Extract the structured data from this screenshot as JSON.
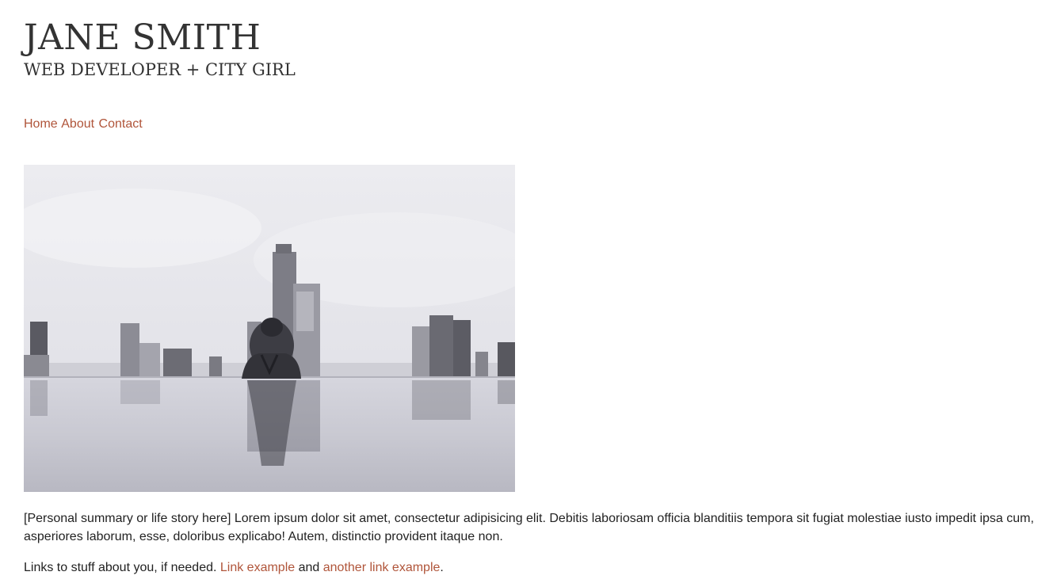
{
  "header": {
    "title": "JANE SMITH",
    "tagline": "WEB DEVELOPER + CITY GIRL"
  },
  "nav": {
    "items": [
      {
        "label": "Home"
      },
      {
        "label": "About"
      },
      {
        "label": "Contact"
      }
    ]
  },
  "hero": {
    "alt": "Woman in an infinity pool facing a city skyline",
    "style": "black-and-white photograph"
  },
  "content": {
    "summary": "[Personal summary or life story here] Lorem ipsum dolor sit amet, consectetur adipisicing elit. Debitis laboriosam officia blanditiis tempora sit fugiat molestiae iusto impedit ipsa cum, asperiores laborum, esse, doloribus explicabo! Autem, distinctio provident itaque non.",
    "links_prefix": "Links to stuff about you, if needed. ",
    "link1": "Link example",
    "links_middle": " and ",
    "link2": "another link example",
    "links_suffix": "."
  },
  "colors": {
    "accent": "#b0553a",
    "text": "#222222",
    "heading": "#333333",
    "background": "#ffffff"
  }
}
